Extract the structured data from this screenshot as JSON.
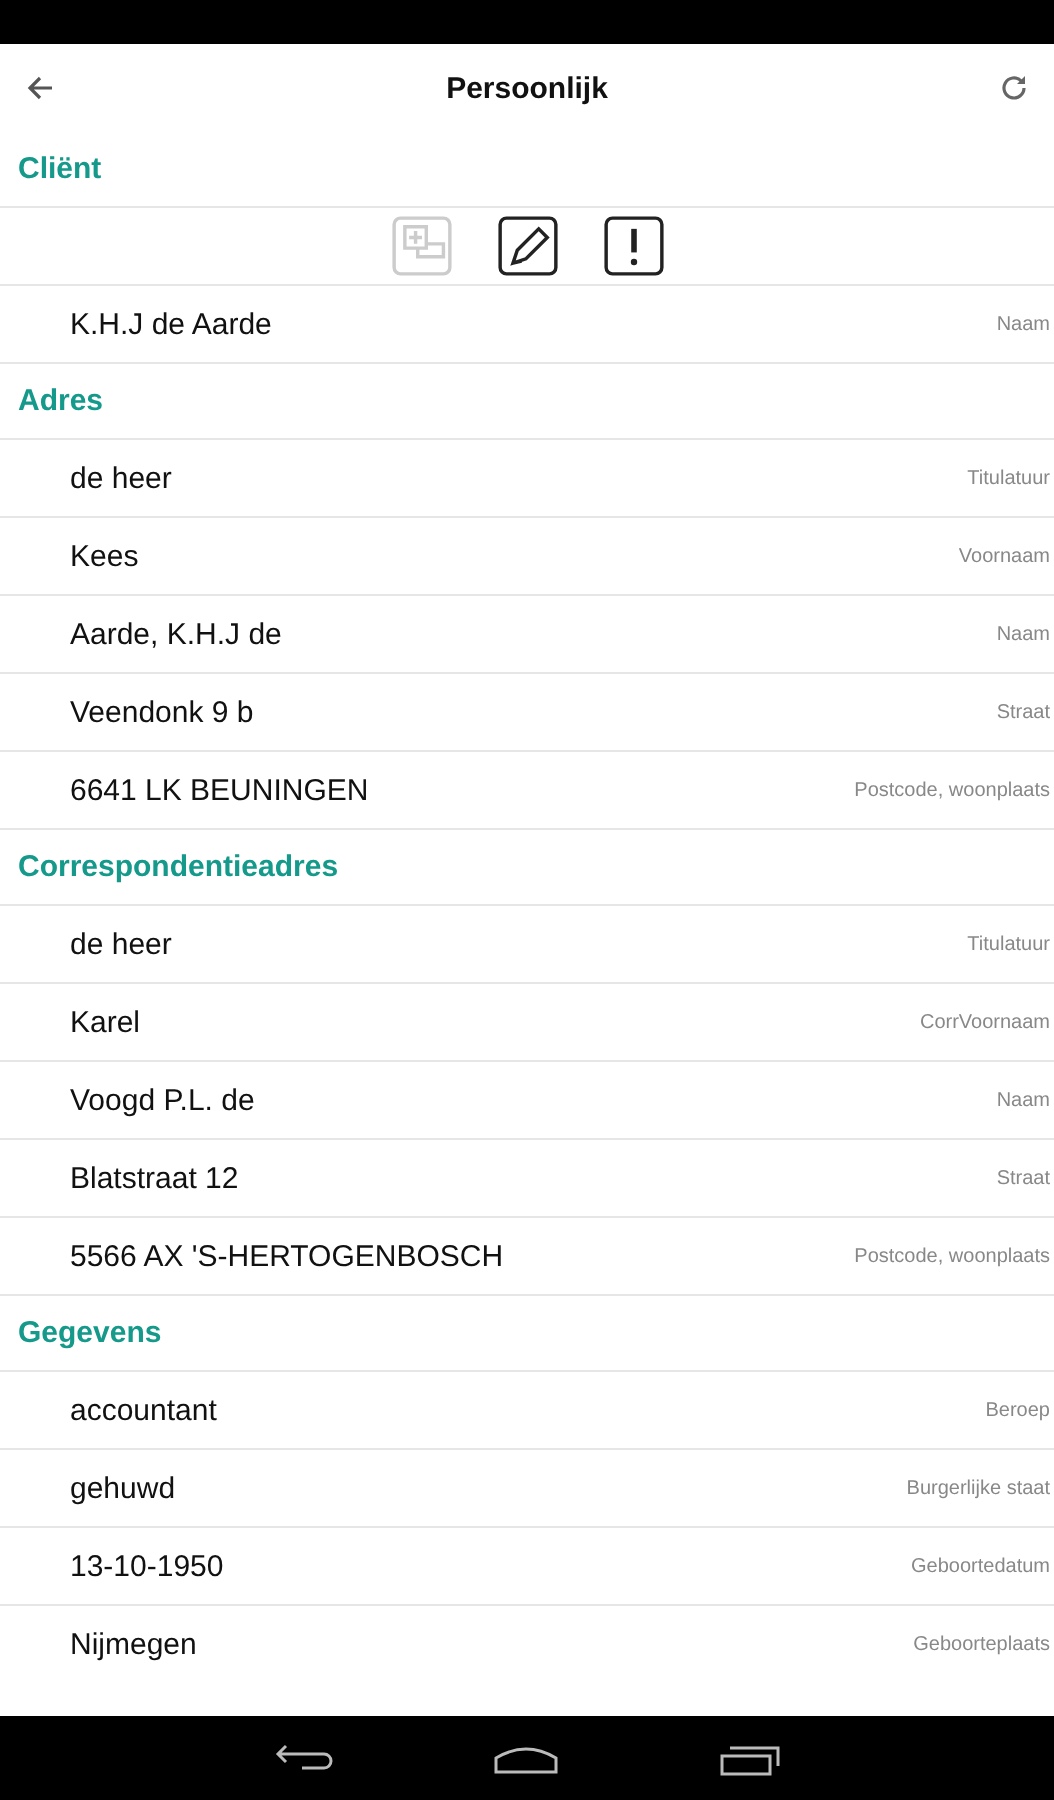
{
  "app_bar": {
    "title": "Persoonlijk"
  },
  "sections": [
    {
      "title": "Cliënt",
      "actions": [
        {
          "kind": "photo",
          "disabled": true
        },
        {
          "kind": "edit",
          "disabled": false
        },
        {
          "kind": "alert",
          "disabled": false
        }
      ],
      "rows": [
        {
          "value": "K.H.J de Aarde",
          "label": "Naam"
        }
      ]
    },
    {
      "title": "Adres",
      "rows": [
        {
          "value": "de heer",
          "label": "Titulatuur"
        },
        {
          "value": "Kees",
          "label": "Voornaam"
        },
        {
          "value": "Aarde, K.H.J de",
          "label": "Naam"
        },
        {
          "value": "Veendonk 9 b",
          "label": "Straat"
        },
        {
          "value": "6641 LK  BEUNINGEN",
          "label": "Postcode, woonplaats"
        }
      ]
    },
    {
      "title": "Correspondentieadres",
      "rows": [
        {
          "value": "de heer",
          "label": "Titulatuur"
        },
        {
          "value": "Karel",
          "label": "CorrVoornaam"
        },
        {
          "value": "Voogd P.L. de",
          "label": "Naam"
        },
        {
          "value": "Blatstraat 12",
          "label": "Straat"
        },
        {
          "value": "5566 AX  'S-HERTOGENBOSCH",
          "label": "Postcode, woonplaats"
        }
      ]
    },
    {
      "title": "Gegevens",
      "rows": [
        {
          "value": "accountant",
          "label": "Beroep"
        },
        {
          "value": "gehuwd",
          "label": "Burgerlijke staat"
        },
        {
          "value": "13-10-1950",
          "label": "Geboortedatum"
        },
        {
          "value": "Nijmegen",
          "label": "Geboorteplaats"
        }
      ]
    }
  ]
}
